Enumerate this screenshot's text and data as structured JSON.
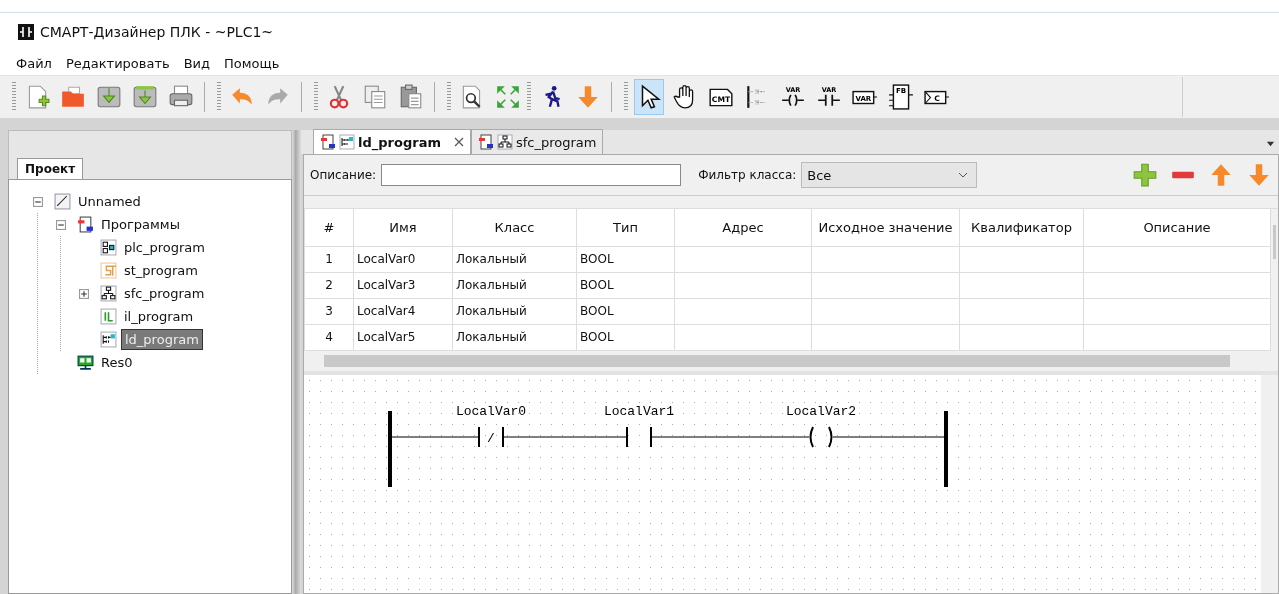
{
  "window": {
    "title": "СМАРТ-Дизайнер ПЛК - ~PLC1~"
  },
  "menu": [
    "Файл",
    "Редактировать",
    "Вид",
    "Помощь"
  ],
  "toolbar": [
    [
      {
        "kind": "new"
      },
      {
        "kind": "open"
      },
      {
        "kind": "save"
      },
      {
        "kind": "saveas"
      },
      {
        "kind": "print"
      }
    ],
    [
      {
        "kind": "undo"
      },
      {
        "kind": "redo"
      }
    ],
    [
      {
        "kind": "cut"
      },
      {
        "kind": "copy"
      },
      {
        "kind": "paste"
      }
    ],
    [
      {
        "kind": "preview"
      },
      {
        "kind": "fit"
      }
    ],
    [
      {
        "kind": "run"
      },
      {
        "kind": "download"
      }
    ],
    [
      {
        "kind": "pointer",
        "selected": true
      },
      {
        "kind": "hand",
        "selected": false
      },
      {
        "kind": "comment",
        "label": "CMT",
        "selected": false
      },
      {
        "kind": "rail",
        "selected": false
      },
      {
        "kind": "coil",
        "label": "VAR",
        "selected": false
      },
      {
        "kind": "contact",
        "label": "VAR",
        "selected": false
      },
      {
        "kind": "variable",
        "label": "VAR",
        "selected": false
      },
      {
        "kind": "block",
        "label": "FB",
        "selected": false
      },
      {
        "kind": "connector",
        "label": "C",
        "selected": false
      }
    ]
  ],
  "project_panel": {
    "tab": "Проект",
    "tree": [
      {
        "label": "Unnamed",
        "kind": "plc",
        "expanded": true,
        "selected": false,
        "children": [
          {
            "label": "Программы",
            "kind": "programs",
            "expanded": true,
            "selected": false,
            "children": [
              {
                "label": "plc_program",
                "kind": "fbd",
                "selected": false
              },
              {
                "label": "st_program",
                "kind": "st",
                "selected": false
              },
              {
                "label": "sfc_program",
                "kind": "sfc",
                "expanded": false,
                "selected": false
              },
              {
                "label": "il_program",
                "kind": "il",
                "selected": false
              },
              {
                "label": "ld_program",
                "kind": "ld",
                "selected": true
              }
            ]
          },
          {
            "label": "Res0",
            "kind": "resource",
            "selected": false
          }
        ]
      }
    ]
  },
  "editor_tabs": [
    {
      "label": "ld_program",
      "kind": "ld",
      "selected": true,
      "closable": true
    },
    {
      "label": "sfc_program",
      "kind": "sfc",
      "selected": false,
      "closable": false
    }
  ],
  "filter": {
    "description_label": "Описание:",
    "class_label": "Фильтр класса:",
    "class_value": "Все"
  },
  "table": {
    "columns": [
      "#",
      "Имя",
      "Класс",
      "Тип",
      "Адрес",
      "Исходное значение",
      "Квалификатор",
      "Описание"
    ],
    "rows": [
      [
        "1",
        "LocalVar0",
        "Локальный",
        "BOOL",
        "",
        "",
        "",
        ""
      ],
      [
        "2",
        "LocalVar3",
        "Локальный",
        "BOOL",
        "",
        "",
        "",
        ""
      ],
      [
        "3",
        "LocalVar4",
        "Локальный",
        "BOOL",
        "",
        "",
        "",
        ""
      ],
      [
        "4",
        "LocalVar5",
        "Локальный",
        "BOOL",
        "",
        "",
        "",
        ""
      ]
    ]
  },
  "ladder": {
    "elements": [
      {
        "kind": "contact_negated",
        "label": "LocalVar0",
        "glyph": "/"
      },
      {
        "kind": "contact",
        "label": "LocalVar1"
      },
      {
        "kind": "coil",
        "label": "LocalVar2"
      }
    ]
  }
}
